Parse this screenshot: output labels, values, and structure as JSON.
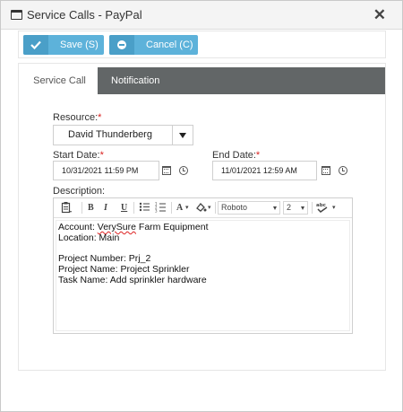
{
  "window": {
    "title": "Service Calls - PayPal",
    "close_glyph": "✕"
  },
  "toolbar": {
    "save_label": "Save (S)",
    "cancel_label": "Cancel (C)"
  },
  "tabs": [
    {
      "label": "Service Call"
    },
    {
      "label": "Notification"
    }
  ],
  "form": {
    "resource": {
      "label": "Resource:",
      "value": "David Thunderberg"
    },
    "start_date": {
      "label": "Start Date:",
      "value": "10/31/2021 11:59 PM"
    },
    "end_date": {
      "label": "End Date:",
      "value": "11/01/2021 12:59 AM"
    },
    "description": {
      "label": "Description:",
      "lines": [
        {
          "prefix": "Account: ",
          "emph": "VerySure",
          "suffix": " Farm Equipment"
        },
        "Location: Main",
        "",
        "Project Number: Prj_2",
        "Project Name: Project Sprinkler",
        "Task Name: Add sprinkler hardware"
      ]
    },
    "required_marker": "*"
  },
  "editor_toolbar": {
    "bold": "B",
    "italic": "I",
    "underline": "U",
    "font_color": "A",
    "font_name": "Roboto",
    "font_size": "2"
  },
  "colors": {
    "accent": "#5db2da",
    "accent_dark": "#4a9fc8",
    "tab_dark": "#626667",
    "required": "#d9211f"
  },
  "icons": [
    "window-icon",
    "close-icon",
    "checkmark-icon",
    "minus-circle-icon",
    "dropdown-arrow-icon",
    "calendar-icon",
    "clock-icon",
    "paste-icon",
    "bullet-list-icon",
    "numbered-list-icon",
    "highlight-icon",
    "spellcheck-icon"
  ]
}
